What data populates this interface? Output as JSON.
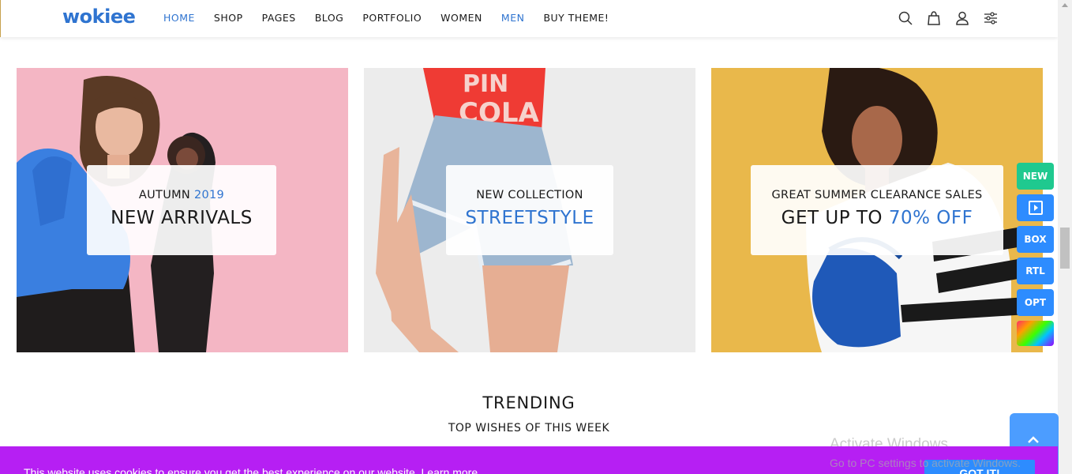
{
  "header": {
    "logo": "wokiee",
    "nav": [
      {
        "label": "HOME",
        "active": true
      },
      {
        "label": "SHOP",
        "active": false
      },
      {
        "label": "PAGES",
        "active": false
      },
      {
        "label": "BLOG",
        "active": false
      },
      {
        "label": "PORTFOLIO",
        "active": false
      },
      {
        "label": "WOMEN",
        "active": false
      },
      {
        "label": "MEN",
        "active": true
      },
      {
        "label": "BUY THEME!",
        "active": false
      }
    ],
    "icons": [
      "search-icon",
      "cart-icon",
      "account-icon",
      "settings-sliders-icon"
    ]
  },
  "banners": [
    {
      "small_prefix": "AUTUMN ",
      "small_accent": "2019",
      "large_prefix": "NEW ARRIVALS",
      "large_accent": ""
    },
    {
      "small_prefix": "NEW COLLECTION",
      "small_accent": "",
      "large_prefix": "",
      "large_accent": "STREETSTYLE"
    },
    {
      "small_prefix": "GREAT SUMMER CLEARANCE SALES",
      "small_accent": "",
      "large_prefix": "GET UP TO ",
      "large_accent": "70% OFF"
    }
  ],
  "banner_image_text": [
    "PIN",
    "COLA"
  ],
  "side_buttons": {
    "new": "NEW",
    "box": "BOX",
    "rtl": "RTL",
    "opt": "OPT"
  },
  "trending": {
    "title": "TRENDING",
    "subtitle": "TOP WISHES OF THIS WEEK"
  },
  "cookie": {
    "text": "This website uses cookies to ensure you get the best experience on our website.",
    "link": "Learn more",
    "button": "GOT IT!"
  },
  "watermark": {
    "line1": "Activate Windows",
    "line2": "Go to PC settings to activate Windows."
  },
  "colors": {
    "accent": "#2f74d0",
    "cookie_bar": "#b61ff3",
    "side_new": "#1fc98f",
    "side_blue": "#2d8cff"
  }
}
